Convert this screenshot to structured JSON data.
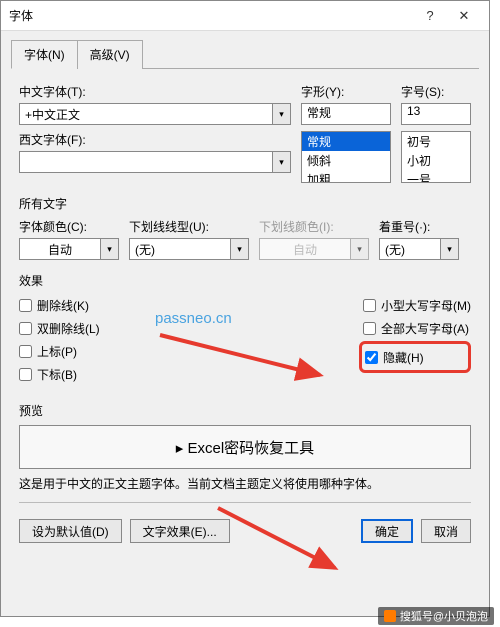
{
  "title": "字体",
  "tabs": {
    "font": "字体(N)",
    "advanced": "高级(V)"
  },
  "labels": {
    "cn_font": "中文字体(T):",
    "west_font": "西文字体(F):",
    "style": "字形(Y):",
    "size": "字号(S):",
    "all_text": "所有文字",
    "font_color": "字体颜色(C):",
    "underline_style": "下划线线型(U):",
    "underline_color": "下划线颜色(I):",
    "emphasis": "着重号(·):",
    "effects": "效果",
    "preview": "预览"
  },
  "values": {
    "cn_font": "+中文正文",
    "west_font": "",
    "style": "常规",
    "size": "13",
    "style_options": [
      "常规",
      "倾斜",
      "加粗"
    ],
    "size_options": [
      "初号",
      "小初",
      "一号"
    ],
    "color_auto": "自动",
    "underline_none": "(无)",
    "underline_color_auto": "自动",
    "emphasis_none": "(无)"
  },
  "effects": {
    "strike": "删除线(K)",
    "dstrike": "双删除线(L)",
    "super": "上标(P)",
    "sub": "下标(B)",
    "smallcaps": "小型大写字母(M)",
    "allcaps": "全部大写字母(A)",
    "hidden": "隐藏(H)"
  },
  "preview_text": "▸ Excel密码恢复工具",
  "preview_desc": "这是用于中文的正文主题字体。当前文档主题定义将使用哪种字体。",
  "buttons": {
    "default": "设为默认值(D)",
    "text_effects": "文字效果(E)...",
    "ok": "确定",
    "cancel": "取消"
  },
  "watermark": "passneo.cn",
  "attribution": "搜狐号@小贝泡泡"
}
